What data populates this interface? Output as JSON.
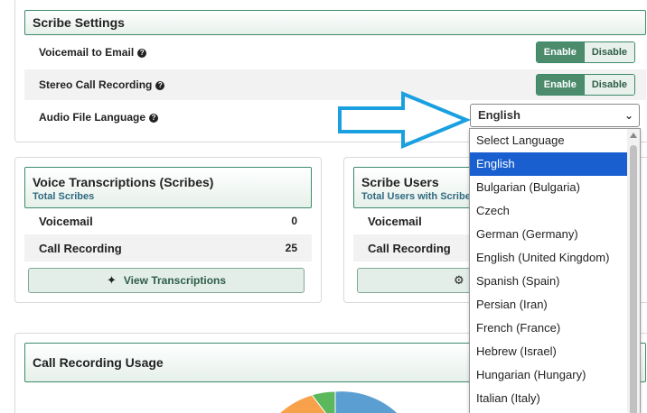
{
  "settings": {
    "title": "Scribe Settings",
    "rows": [
      {
        "label": "Voicemail to Email",
        "enable": "Enable",
        "disable": "Disable"
      },
      {
        "label": "Stereo Call Recording",
        "enable": "Enable",
        "disable": "Disable"
      },
      {
        "label": "Audio File Language"
      }
    ],
    "language_value": "English"
  },
  "voice": {
    "title": "Voice Transcriptions (Scribes)",
    "subtitle": "Total Scribes",
    "rows": [
      {
        "label": "Voicemail",
        "value": "0"
      },
      {
        "label": "Call Recording",
        "value": "25"
      }
    ],
    "button": "View Transcriptions"
  },
  "users": {
    "title": "Scribe Users",
    "subtitle": "Total Users with Scribe",
    "rows": [
      {
        "label": "Voicemail"
      },
      {
        "label": "Call Recording"
      }
    ]
  },
  "usage": {
    "title": "Call Recording Usage"
  },
  "dropdown": {
    "options": [
      "Select Language",
      "English",
      "Bulgarian (Bulgaria)",
      "Czech",
      "German (Germany)",
      "English (United Kingdom)",
      "Spanish (Spain)",
      "Persian (Iran)",
      "French (France)",
      "Hebrew (Israel)",
      "Hungarian (Hungary)",
      "Italian (Italy)"
    ],
    "selected_index": 1
  },
  "colors": {
    "accent_green": "#4c8c6d",
    "arrow_blue": "#1aa0e0",
    "selected_blue": "#1a5fd0",
    "pie_blue": "#5b9fd2",
    "pie_orange": "#f7a14a",
    "pie_green": "#5cb85c"
  }
}
